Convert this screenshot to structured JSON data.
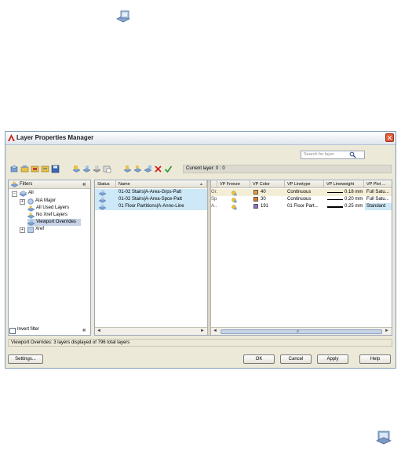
{
  "window": {
    "title": "Layer Properties Manager",
    "close_glyph": "✕"
  },
  "search": {
    "placeholder": "Search for layer"
  },
  "current_layer": "Current layer: 0 : 0",
  "filters": {
    "header": "Filters",
    "collapse_glyph": "«",
    "items": [
      {
        "label": "All",
        "expander": "−"
      },
      {
        "label": "AIA Major",
        "expander": "+"
      },
      {
        "label": "All Used Layers",
        "expander": ""
      },
      {
        "label": "No Xref Layers",
        "expander": ""
      },
      {
        "label": "Viewport Overrides",
        "expander": ""
      },
      {
        "label": "Xref",
        "expander": "+"
      }
    ],
    "invert_label": "Invert filter"
  },
  "grid": {
    "columns": [
      "Status",
      "Name",
      "VP Freeze",
      "VP Color",
      "VP Linetype",
      "VP Lineweight",
      "VP Plot ..."
    ],
    "rows": [
      {
        "name": "01-02 Stairs|A-Area-Grps-Patt",
        "trunc": "Gr...",
        "color_value": "40",
        "color_hex": "#e8a030",
        "linetype": "Continuous",
        "lineweight": "0.18 mm",
        "plot": "Full Satu..."
      },
      {
        "name": "01-02 Stairs|A-Area-Spce-Patt",
        "trunc": "Sp...",
        "color_value": "30",
        "color_hex": "#e87820",
        "linetype": "Continuous",
        "lineweight": "0.20 mm",
        "plot": "Full Satu..."
      },
      {
        "name": "01 Floor Partitions|A-Anno-Line",
        "trunc": "A...",
        "color_value": "191",
        "color_hex": "#9070c8",
        "linetype": "01 Floor Part...",
        "lineweight": "0.25 mm",
        "plot": "Standard"
      }
    ],
    "scroll_left": "◄",
    "scroll_right": "►",
    "scroll_mid": "|||"
  },
  "status_text": "Viewport Overrides: 3 layers displayed of 796 total layers",
  "buttons": {
    "settings": "Settings...",
    "ok": "OK",
    "cancel": "Cancel",
    "apply": "Apply",
    "help": "Help"
  },
  "colors": {
    "selection": "#c6d2e6",
    "highlight_row": "#f5eed6",
    "cyan_cell": "#cde8f6"
  }
}
